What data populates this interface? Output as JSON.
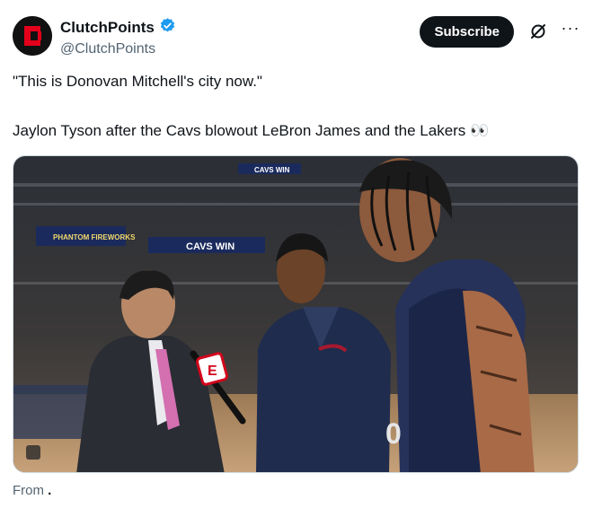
{
  "account": {
    "display_name": "ClutchPoints",
    "handle": "@ClutchPoints",
    "avatar_icon": "clutchpoints-logo-icon",
    "verified_icon": "verified-badge-icon",
    "verified_color": "#1d9bf0",
    "brand_color": "#e4001b"
  },
  "actions": {
    "subscribe_label": "Subscribe",
    "grok_icon": "grok-icon",
    "more_icon": "more-options-icon"
  },
  "tweet": {
    "line1": "\"This is Donovan Mitchell's city now.\"",
    "line2": "Jaylon Tyson after the Cavs blowout LeBron James and the Lakers 👀"
  },
  "media": {
    "banner_cavs_win_1": "CAVS WIN",
    "banner_cavs_win_2": "CAVS WIN",
    "banner_phantom": "PHANTOM FIREWORKS",
    "mic_logo": "E"
  },
  "footer": {
    "from_label": "From",
    "from_source": "."
  }
}
